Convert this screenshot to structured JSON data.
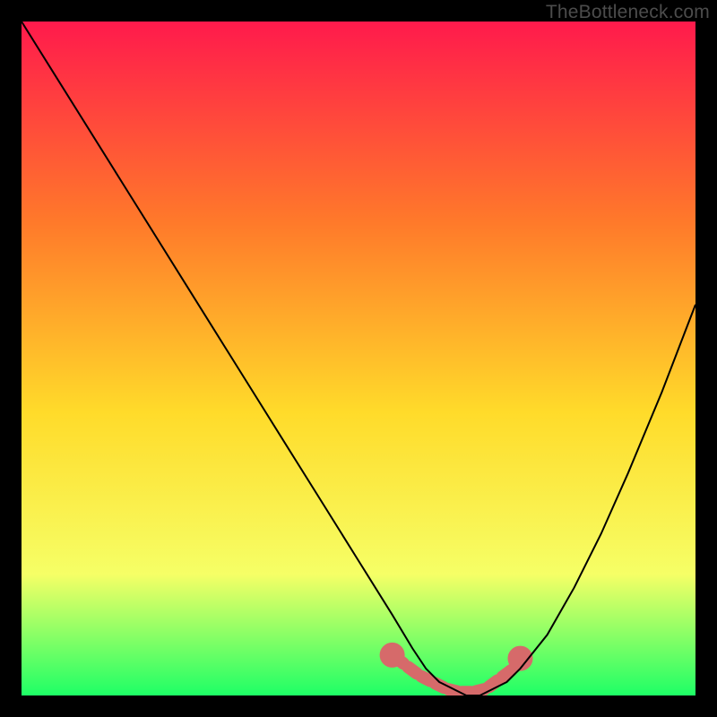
{
  "watermark": "TheBottleneck.com",
  "colors": {
    "background": "#000000",
    "gradient_top": "#ff1a4c",
    "gradient_mid_upper": "#ff7a2a",
    "gradient_mid": "#ffdb2a",
    "gradient_lower": "#f6ff66",
    "gradient_bottom": "#1eff66",
    "curve": "#000000",
    "marker": "#d66a6a"
  },
  "chart_data": {
    "type": "line",
    "title": "",
    "xlabel": "",
    "ylabel": "",
    "xlim": [
      0,
      100
    ],
    "ylim": [
      0,
      100
    ],
    "grid": false,
    "legend": null,
    "series": [
      {
        "name": "bottleneck-curve",
        "x": [
          0,
          5,
          10,
          15,
          20,
          25,
          30,
          35,
          40,
          45,
          50,
          55,
          58,
          60,
          62,
          64,
          66,
          68,
          70,
          72,
          74,
          78,
          82,
          86,
          90,
          95,
          100
        ],
        "values": [
          100,
          92,
          84,
          76,
          68,
          60,
          52,
          44,
          36,
          28,
          20,
          12,
          7,
          4,
          2,
          1,
          0,
          0,
          1,
          2,
          4,
          9,
          16,
          24,
          33,
          45,
          58
        ]
      }
    ],
    "markers": {
      "name": "highlight-region",
      "x": [
        55,
        57,
        59,
        61,
        63,
        65,
        67,
        69,
        71,
        73,
        74
      ],
      "values": [
        6,
        4.5,
        3,
        2,
        1,
        0.5,
        0.5,
        1,
        2.5,
        4,
        5.5
      ]
    }
  }
}
